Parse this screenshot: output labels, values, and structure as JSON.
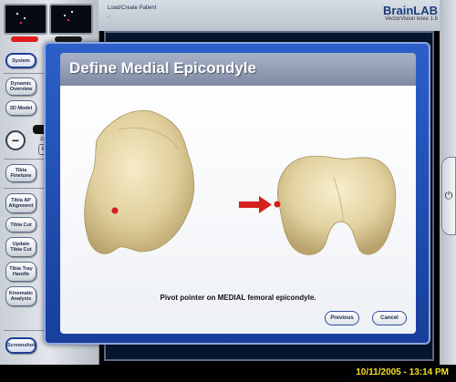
{
  "header": {
    "load_label": "Load/Create Patient",
    "load_sub": ".·",
    "brand": "BrainLAB",
    "product": "VectorVision knee 1.6"
  },
  "sidebar": {
    "system": "System",
    "dynamic_overview": "Dynamic Overview",
    "model_3d": "3D Model",
    "zoom": "Zoo",
    "reset": "Res",
    "tibia_finetune": "Tibia Finetune",
    "tibia_ap": "Tibia AP Alignment",
    "tibia_cut": "Tibia Cut",
    "update_tibia_cut": "Update Tibia Cut",
    "tibia_tray": "Tibia Tray Handle",
    "kinematic": "Kinematic Analysis",
    "screenshot": "Screenshot"
  },
  "dialog": {
    "title": "Define Medial Epicondyle",
    "instruction": "Pivot pointer on MEDIAL femoral epicondyle.",
    "previous": "Previous",
    "cancel": "Cancel"
  },
  "status": {
    "datetime": "10/11/2005 - 13:14 PM"
  },
  "colors": {
    "dialog_frame": "#2c5fc9",
    "title_bar": "#a8b2c6",
    "datetime": "#f3e02a",
    "marker": "#d41f1f"
  },
  "icons": {
    "power": "power-icon",
    "minus": "zoom-out-icon",
    "arrow": "arrow-right-icon"
  }
}
